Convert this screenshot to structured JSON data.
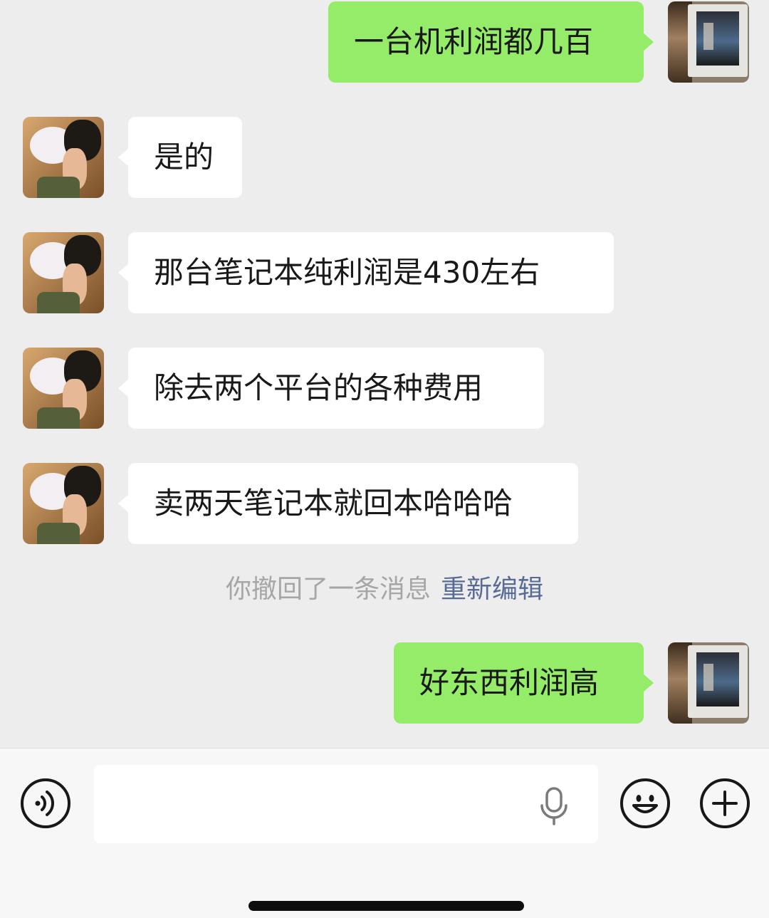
{
  "conversation": {
    "messages": [
      {
        "sender": "self",
        "text": "一台机利润都几百"
      },
      {
        "sender": "other",
        "text": "是的"
      },
      {
        "sender": "other",
        "text": "那台笔记本纯利润是430左右"
      },
      {
        "sender": "other",
        "text": "除去两个平台的各种费用"
      },
      {
        "sender": "other",
        "text": "卖两天笔记本就回本哈哈哈"
      },
      {
        "sender": "self",
        "text": "好东西利润高"
      }
    ],
    "system_notice": {
      "recall_text": "你撤回了一条消息",
      "reedit_link": "重新编辑"
    }
  },
  "input_bar": {
    "message_input_value": "",
    "icons": {
      "voice": "voice-mode-icon",
      "mic": "microphone-icon",
      "emoji": "emoji-icon",
      "plus": "plus-icon"
    }
  },
  "colors": {
    "chat_background": "#ededed",
    "self_bubble": "#95ec69",
    "other_bubble": "#ffffff",
    "link": "#576b95",
    "system_text": "#a6a6a6"
  }
}
